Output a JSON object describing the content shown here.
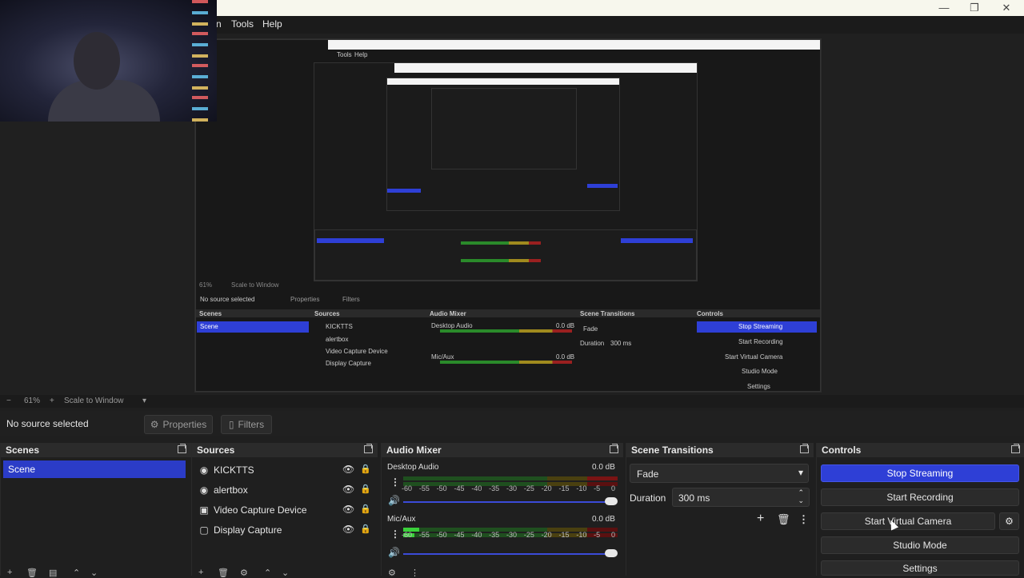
{
  "window": {
    "controls": [
      "—",
      "❐",
      "✕"
    ]
  },
  "menu": {
    "partial": "n",
    "items": [
      "Tools",
      "Help"
    ]
  },
  "preview": {
    "nested": {
      "menu": [
        "Tools",
        "Help"
      ],
      "zoom": "61%",
      "scale_mode": "Scale to Window",
      "no_source": "No source selected",
      "properties": "Properties",
      "filters": "Filters",
      "docks": [
        "Scenes",
        "Sources",
        "Audio Mixer",
        "Scene Transitions",
        "Controls"
      ],
      "scene": "Scene",
      "sources": [
        "KICKTTS",
        "alertbox",
        "Video Capture Device",
        "Display Capture"
      ],
      "mixer": [
        {
          "name": "Desktop Audio",
          "db": "0.0 dB"
        },
        {
          "name": "Mic/Aux",
          "db": "0.0 dB"
        }
      ],
      "transition": "Fade",
      "duration_label": "Duration",
      "duration_value": "300 ms",
      "controls": [
        "Stop Streaming",
        "Start Recording",
        "Start Virtual Camera",
        "Studio Mode",
        "Settings"
      ]
    }
  },
  "zoombar": {
    "minus": "−",
    "zoom": "61%",
    "plus": "+",
    "scale_mode": "Scale to Window"
  },
  "source_toolbar": {
    "no_source": "No source selected",
    "properties": "Properties",
    "filters": "Filters"
  },
  "scenes": {
    "title": "Scenes",
    "items": [
      "Scene"
    ]
  },
  "sources": {
    "title": "Sources",
    "items": [
      {
        "label": "KICKTTS",
        "icon": "browser-icon"
      },
      {
        "label": "alertbox",
        "icon": "browser-icon"
      },
      {
        "label": "Video Capture Device",
        "icon": "camera-icon"
      },
      {
        "label": "Display Capture",
        "icon": "monitor-icon"
      }
    ]
  },
  "mixer": {
    "title": "Audio Mixer",
    "ticks": [
      "-60",
      "-55",
      "-50",
      "-45",
      "-40",
      "-35",
      "-30",
      "-25",
      "-20",
      "-15",
      "-10",
      "-5",
      "0"
    ],
    "channels": [
      {
        "name": "Desktop Audio",
        "db": "0.0 dB",
        "volume": 1.0,
        "level": 0.0
      },
      {
        "name": "Mic/Aux",
        "db": "0.0 dB",
        "volume": 1.0,
        "level": 0.08
      }
    ]
  },
  "transitions": {
    "title": "Scene Transitions",
    "selected": "Fade",
    "duration_label": "Duration",
    "duration_value": "300 ms"
  },
  "controls": {
    "title": "Controls",
    "stop_streaming": "Stop Streaming",
    "start_recording": "Start Recording",
    "start_virtual_camera": "Start Virtual Camera",
    "studio_mode": "Studio Mode",
    "settings": "Settings"
  },
  "colors": {
    "accent": "#2e3fd6",
    "background": "#1f1f1f",
    "dock_header": "#2b2b2b"
  }
}
